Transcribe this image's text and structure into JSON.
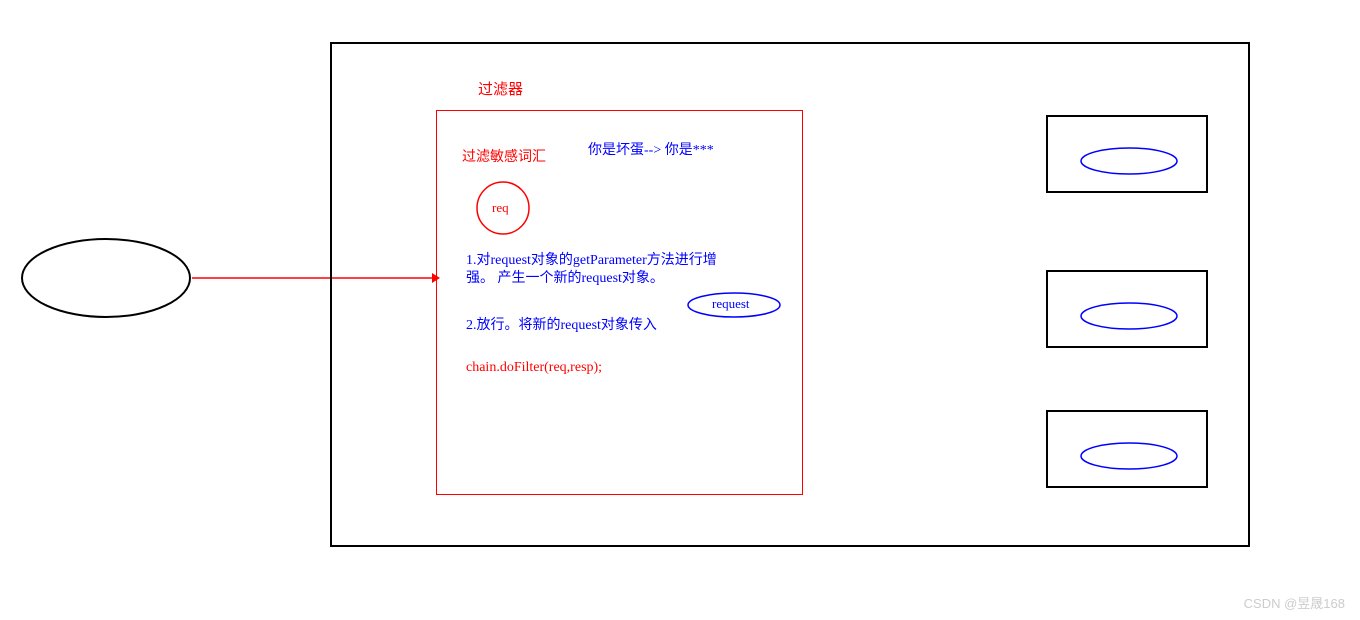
{
  "title": "过滤器",
  "subtitle": "过滤敏感词汇",
  "example": "你是坏蛋--> 你是***",
  "circleLabel": "req",
  "step1": "1.对request对象的getParameter方法进行增强。  产生一个新的request对象。",
  "step2": "2.放行。将新的request对象传入",
  "codeCall": "chain.doFilter(req,resp);",
  "requestEllipseLabel": "request",
  "watermark": "CSDN @昱晟168"
}
